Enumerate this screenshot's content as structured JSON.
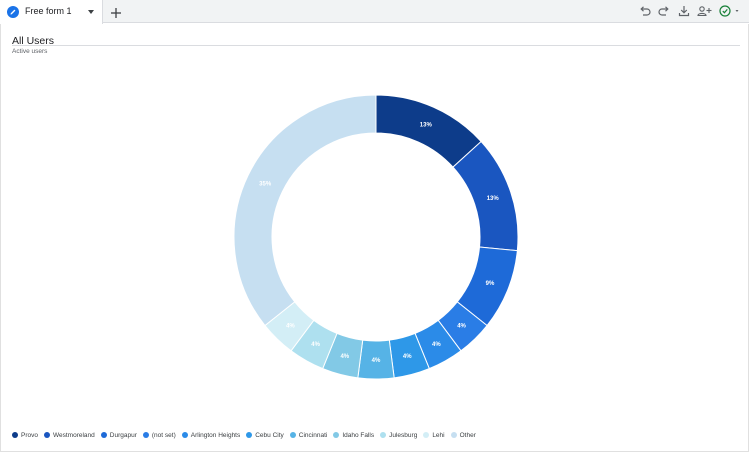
{
  "tabs": [
    {
      "label": "Free form 1",
      "icon": "pencil-icon",
      "selected": true
    }
  ],
  "toolbar": {
    "icons": [
      "add-tab-icon",
      "undo-icon",
      "redo-icon",
      "download-icon",
      "share-users-icon",
      "check-status-icon",
      "chevron-down-icon"
    ]
  },
  "visualization": {
    "title": "All Users",
    "subtitle": "Active users"
  },
  "colors": {
    "accent": "#1a73e8",
    "status_ok": "#188038"
  },
  "chart_data": {
    "type": "pie",
    "donut": true,
    "labels": [
      "Provo",
      "Westmoreland",
      "Durgapur",
      "(not set)",
      "Arlington Heights",
      "Cebu City",
      "Cincinnati",
      "Idaho Falls",
      "Julesburg",
      "Lehi",
      "Other"
    ],
    "values": [
      13,
      13,
      9,
      4,
      4,
      4,
      4,
      4,
      4,
      4,
      35
    ],
    "slice_labels": [
      "13%",
      "13%",
      "9%",
      "4%",
      "4%",
      "4%",
      "4%",
      "4%",
      "4%",
      "4%",
      "35%"
    ],
    "colors": [
      "#0d3c8a",
      "#1a56c0",
      "#1e6ad8",
      "#2a7de6",
      "#2b8be8",
      "#2e98e8",
      "#56b3e6",
      "#82c9e6",
      "#aee0ef",
      "#d3eef6",
      "#c6dff1"
    ],
    "legend_position": "bottom-left"
  }
}
